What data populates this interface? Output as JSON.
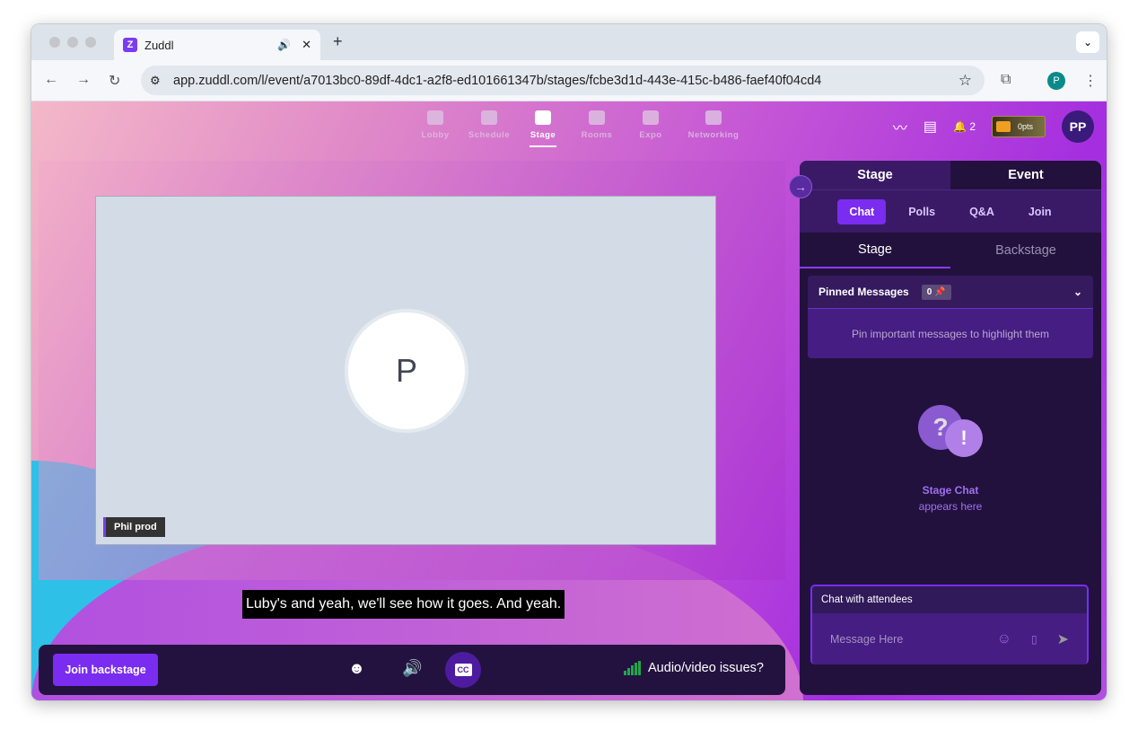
{
  "browser": {
    "tab_title": "Zuddl",
    "url": "app.zuddl.com/l/event/a7013bc0-89df-4dc1-a2f8-ed101661347b/stages/fcbe3d1d-443e-415c-b486-faef40f04cd4",
    "profile_initial": "P"
  },
  "nav": [
    {
      "label": "Lobby"
    },
    {
      "label": "Schedule"
    },
    {
      "label": "Stage",
      "active": true
    },
    {
      "label": "Rooms"
    },
    {
      "label": "Expo"
    },
    {
      "label": "Networking"
    }
  ],
  "header": {
    "notifications": "2",
    "points": "0pts",
    "user_initials": "PP"
  },
  "stage": {
    "speaker_initial": "P",
    "speaker_name": "Phil prod",
    "caption": "Luby's and yeah, we'll see how it goes. And yeah."
  },
  "controls": {
    "join_backstage": "Join backstage",
    "cc": "CC",
    "av_issues": "Audio/video issues?"
  },
  "panel": {
    "tabs": [
      "Stage",
      "Event"
    ],
    "subtabs": [
      "Chat",
      "Polls",
      "Q&A",
      "Join"
    ],
    "chat_tabs": [
      "Stage",
      "Backstage"
    ],
    "pinned_title": "Pinned Messages",
    "pinned_count": "0",
    "pinned_empty": "Pin important messages to highlight them",
    "empty_title": "Stage Chat",
    "empty_sub": "appears here",
    "chat_header": "Chat with attendees",
    "message_placeholder": "Message Here"
  }
}
